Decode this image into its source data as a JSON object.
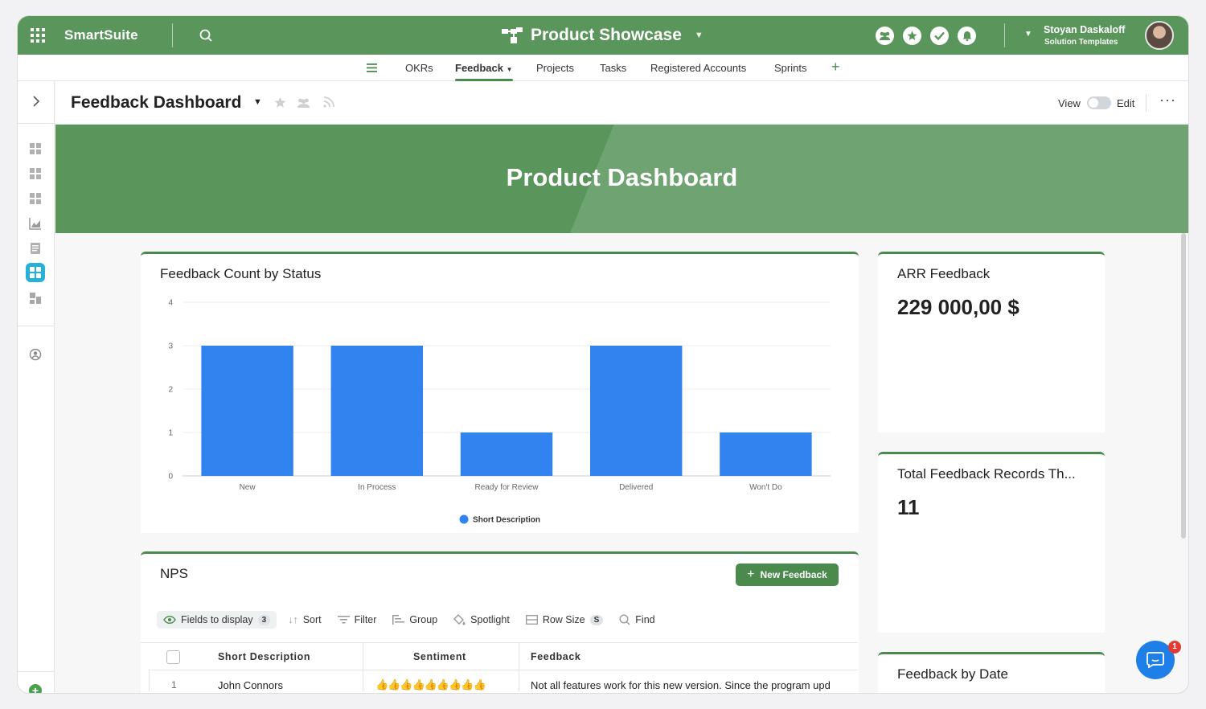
{
  "topbar": {
    "brand": "SmartSuite",
    "workspace_title": "Product Showcase",
    "user_name": "Stoyan Daskaloff",
    "user_role": "Solution Templates",
    "accent": "#5a955b"
  },
  "tabs": [
    {
      "label": "OKRs"
    },
    {
      "label": "Feedback",
      "active": true
    },
    {
      "label": "Projects"
    },
    {
      "label": "Tasks"
    },
    {
      "label": "Registered Accounts"
    },
    {
      "label": "Sprints"
    }
  ],
  "page": {
    "title": "Feedback Dashboard",
    "view_label": "View",
    "edit_label": "Edit",
    "more": "···"
  },
  "banner": {
    "title": "Product Dashboard"
  },
  "cards": {
    "arr_title": "ARR Feedback",
    "arr_value": "229 000,00 $",
    "total_title": "Total Feedback Records Th...",
    "total_value": "11",
    "date_title": "Feedback by Date"
  },
  "chart_data": {
    "type": "bar",
    "title": "Feedback Count by Status",
    "categories": [
      "New",
      "In Process",
      "Ready for Review",
      "Delivered",
      "Won't Do"
    ],
    "series": [
      {
        "name": "Short Description",
        "values": [
          3,
          3,
          1,
          3,
          1
        ],
        "color": "#3183f0"
      }
    ],
    "yticks": [
      "0",
      "1",
      "2",
      "3",
      "4"
    ],
    "ylim": [
      0,
      4
    ],
    "grid": true,
    "legend": "bottom"
  },
  "nps": {
    "title": "NPS",
    "new_button": "New Feedback",
    "toolbar": {
      "fields": "Fields to display",
      "fields_count": "3",
      "sort": "Sort",
      "filter": "Filter",
      "group": "Group",
      "spotlight": "Spotlight",
      "row_size": "Row Size",
      "row_size_value": "S",
      "find": "Find"
    },
    "columns": [
      "Short Description",
      "Sentiment",
      "Feedback"
    ],
    "rows": [
      {
        "num": "1",
        "short_description": "John Connors",
        "sentiment": "👍👍👍👍👍👍👍👍👍",
        "feedback": "Not all features work for this new version. Since the program upd"
      }
    ]
  },
  "chat": {
    "badge": "1"
  }
}
